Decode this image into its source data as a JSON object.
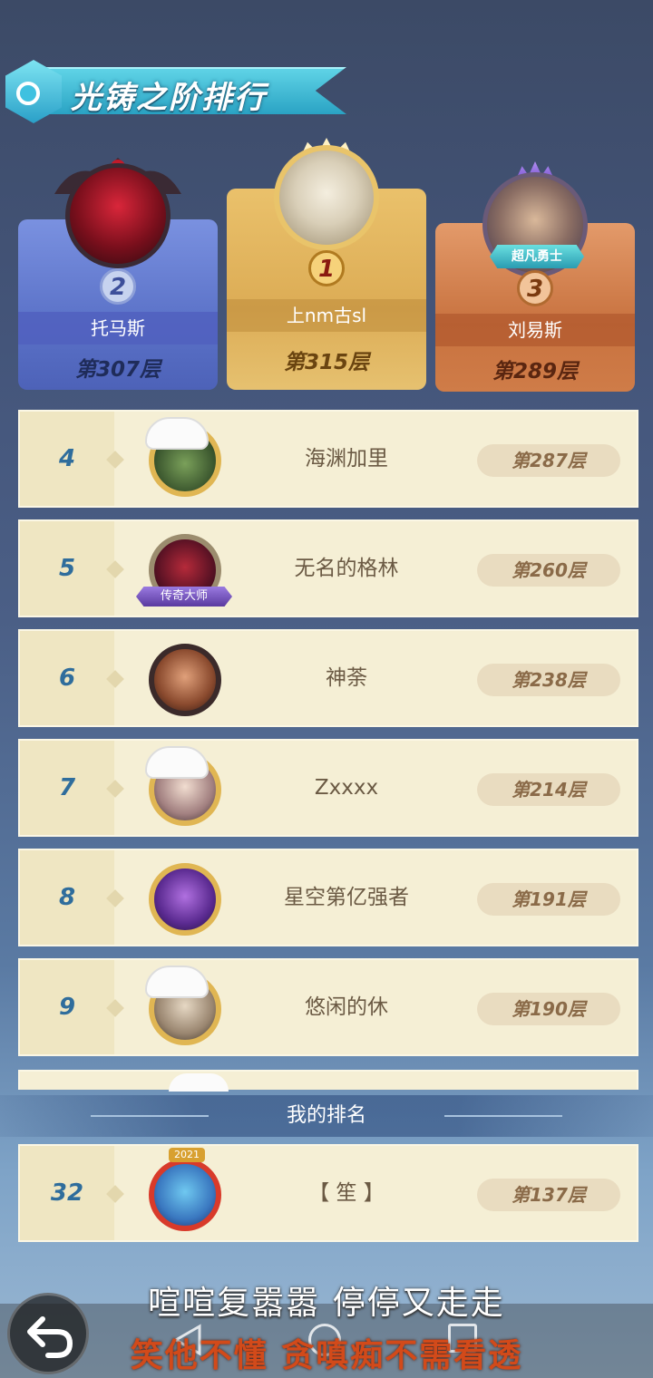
{
  "header": {
    "title": "光铸之阶排行"
  },
  "podium": [
    {
      "rank": "2",
      "name": "托马斯",
      "floor": "第307层"
    },
    {
      "rank": "1",
      "name": "上nm古sl",
      "floor": "第315层"
    },
    {
      "rank": "3",
      "name": "刘易斯",
      "floor": "第289层",
      "tag": "超凡勇士"
    }
  ],
  "rows": [
    {
      "rank": "4",
      "name": "海渊加里",
      "floor": "第287层"
    },
    {
      "rank": "5",
      "name": "无名的格林",
      "floor": "第260层",
      "badge": "传奇大师"
    },
    {
      "rank": "6",
      "name": "神荼",
      "floor": "第238层"
    },
    {
      "rank": "7",
      "name": "Zxxxx",
      "floor": "第214层"
    },
    {
      "rank": "8",
      "name": "星空第亿强者",
      "floor": "第191层"
    },
    {
      "rank": "9",
      "name": "悠闲的休",
      "floor": "第190层"
    }
  ],
  "my_rank": {
    "label": "我的排名",
    "rank": "32",
    "name": "【 笙 】",
    "floor": "第137层",
    "frame_year": "2021"
  },
  "subtitles": {
    "line1": "喧喧复嚣嚣 停停又走走",
    "line2": "笑他不懂 贪嗔痴不需看透"
  },
  "icons": {
    "title": "shield-emblem-icon",
    "back": "back-arrow-icon",
    "nav_back": "triangle-back-icon",
    "nav_home": "circle-home-icon",
    "nav_recent": "square-recent-icon"
  }
}
